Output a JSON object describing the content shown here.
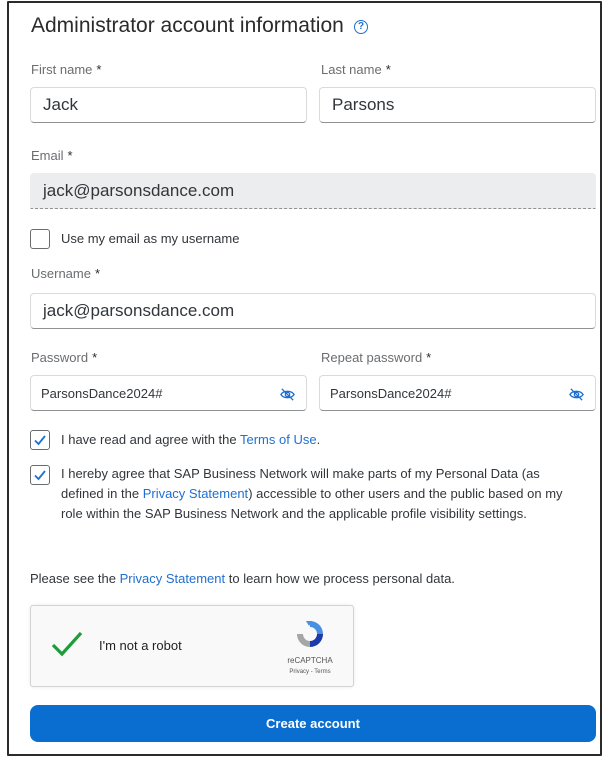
{
  "form": {
    "title": "Administrator account information",
    "help_icon": "?",
    "required_marker": "*",
    "first_name": {
      "label": "First name",
      "value": "Jack"
    },
    "last_name": {
      "label": "Last name",
      "value": "Parsons"
    },
    "email": {
      "label": "Email",
      "value": "jack@parsonsdance.com"
    },
    "use_email_checkbox": {
      "label": "Use my email as my username",
      "checked": false
    },
    "username": {
      "label": "Username",
      "value": "jack@parsonsdance.com"
    },
    "password": {
      "label": "Password",
      "value": "ParsonsDance2024#"
    },
    "repeat_password": {
      "label": "Repeat password",
      "value": "ParsonsDance2024#"
    },
    "terms": {
      "prefix": "I have read and agree with the ",
      "link": "Terms of Use",
      "suffix": ".",
      "checked": true
    },
    "privacy_agreement": {
      "prefix": "I hereby agree that SAP Business Network will make parts of my Personal Data (as defined in the ",
      "link": "Privacy Statement",
      "suffix": ") accessible to other users and the public based on my role within the SAP Business Network and the applicable profile visibility settings.",
      "checked": true
    },
    "privacy_note": {
      "prefix": "Please see the ",
      "link": "Privacy Statement",
      "suffix": " to learn how we process personal data."
    },
    "captcha": {
      "label": "I'm not a robot",
      "brand": "reCAPTCHA",
      "footer": "Privacy - Terms"
    },
    "submit_label": "Create account"
  },
  "colors": {
    "accent": "#0a6ed1",
    "link": "#1f6fd1",
    "check": "#1f9c3a"
  },
  "icons": [
    "help-icon",
    "eye-slash-icon",
    "checkmark-icon",
    "recaptcha-logo"
  ]
}
